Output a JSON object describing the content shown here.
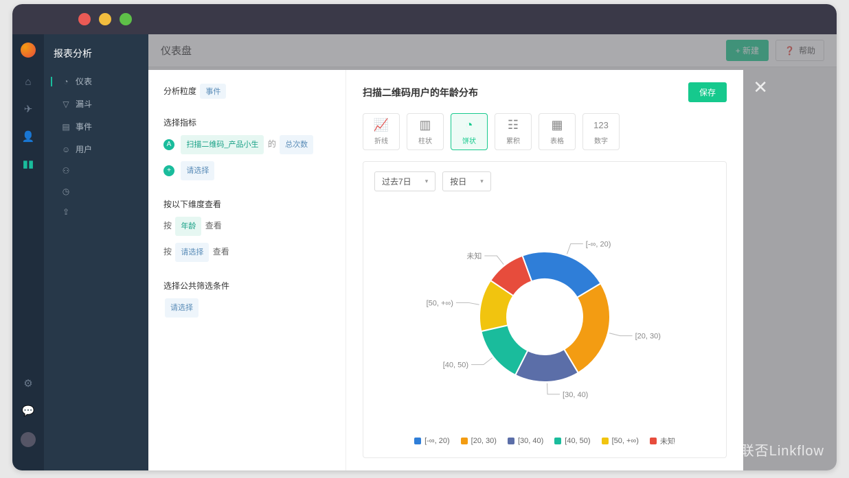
{
  "titlebar": {},
  "subnav": {
    "title": "报表分析",
    "items": [
      "仪表",
      "漏斗",
      "事件",
      "用户",
      "",
      "",
      ""
    ]
  },
  "topbar": {
    "title": "仪表盘",
    "new_btn": "+ 新建",
    "help_btn": "帮助"
  },
  "config": {
    "granularity_label": "分析粒度",
    "granularity_value": "事件",
    "metric_label": "选择指标",
    "metric_A": "扫描二维码_产品小生",
    "metric_of": "的",
    "metric_count": "总次数",
    "metric_add": "请选择",
    "dimension_label": "按以下维度查看",
    "dim_prefix": "按",
    "dim_value": "年龄",
    "dim_suffix": "查看",
    "dim_add_value": "请选择",
    "filter_label": "选择公共筛选条件",
    "filter_add": "请选择"
  },
  "chart": {
    "title": "扫描二维码用户的年龄分布",
    "save": "保存",
    "types": [
      {
        "icon": "line",
        "label": "折线"
      },
      {
        "icon": "bar",
        "label": "柱状"
      },
      {
        "icon": "pie",
        "label": "饼状"
      },
      {
        "icon": "area",
        "label": "累积"
      },
      {
        "icon": "table",
        "label": "表格"
      },
      {
        "icon": "number",
        "label": "数字"
      }
    ],
    "range": "过去7日",
    "interval": "按日"
  },
  "chart_data": {
    "type": "pie",
    "title": "扫描二维码用户的年龄分布",
    "series": [
      {
        "name": "[-∞, 20)",
        "value": 22,
        "color": "#2f7ed8"
      },
      {
        "name": "[20, 30)",
        "value": 25,
        "color": "#f39c12"
      },
      {
        "name": "[30, 40)",
        "value": 16,
        "color": "#5b6ea8"
      },
      {
        "name": "[40, 50)",
        "value": 14,
        "color": "#1abc9c"
      },
      {
        "name": "[50, +∞)",
        "value": 13,
        "color": "#f1c40f"
      },
      {
        "name": "未知",
        "value": 10,
        "color": "#e74c3c"
      }
    ]
  },
  "watermark": "知乎  @联否Linkflow"
}
